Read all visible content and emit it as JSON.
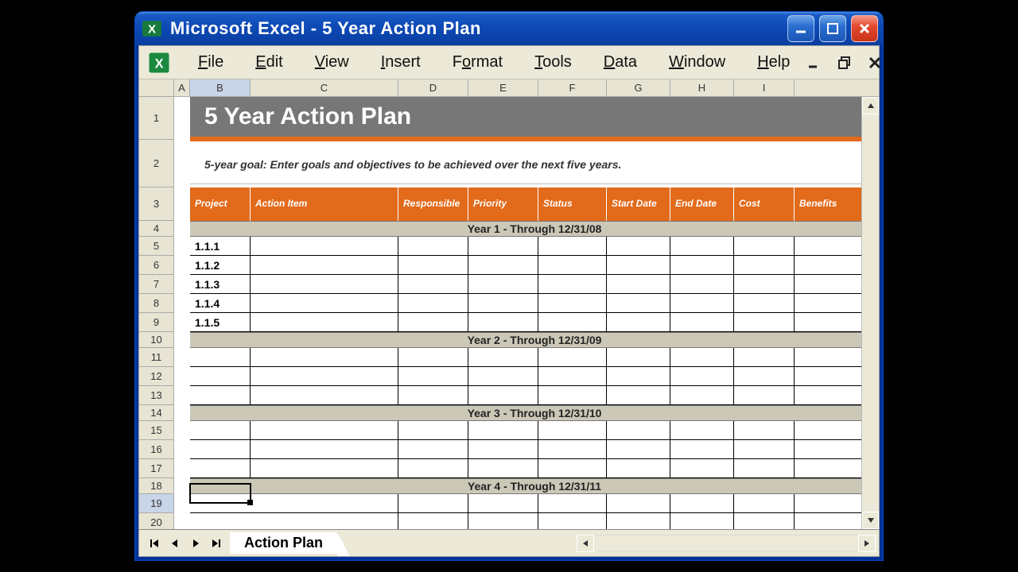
{
  "window": {
    "title": "Microsoft Excel - 5 Year Action Plan"
  },
  "menu": {
    "file": "File",
    "edit": "Edit",
    "view": "View",
    "insert": "Insert",
    "format": "Format",
    "tools": "Tools",
    "data": "Data",
    "window": "Window",
    "help": "Help"
  },
  "columns": [
    "A",
    "B",
    "C",
    "D",
    "E",
    "F",
    "G",
    "H",
    "I"
  ],
  "rows": [
    1,
    2,
    3,
    4,
    5,
    6,
    7,
    8,
    9,
    10,
    11,
    12,
    13,
    14,
    15,
    16,
    17,
    18,
    19,
    20
  ],
  "sheet": {
    "title": "5 Year Action Plan",
    "goal_text": "5-year goal: Enter goals and objectives to be achieved over the next five years.",
    "headers": {
      "project": "Project",
      "action_item": "Action Item",
      "responsible": "Responsible",
      "priority": "Priority",
      "status": "Status",
      "start_date": "Start Date",
      "end_date": "End Date",
      "cost": "Cost",
      "benefits": "Benefits"
    },
    "year1": "Year 1 - Through 12/31/08",
    "year2": "Year 2 - Through 12/31/09",
    "year3": "Year 3 - Through 12/31/10",
    "year4": "Year 4 - Through 12/31/11",
    "y1rows": [
      "1.1.1",
      "1.1.2",
      "1.1.3",
      "1.1.4",
      "1.1.5"
    ]
  },
  "tabs": {
    "active": "Action Plan"
  }
}
